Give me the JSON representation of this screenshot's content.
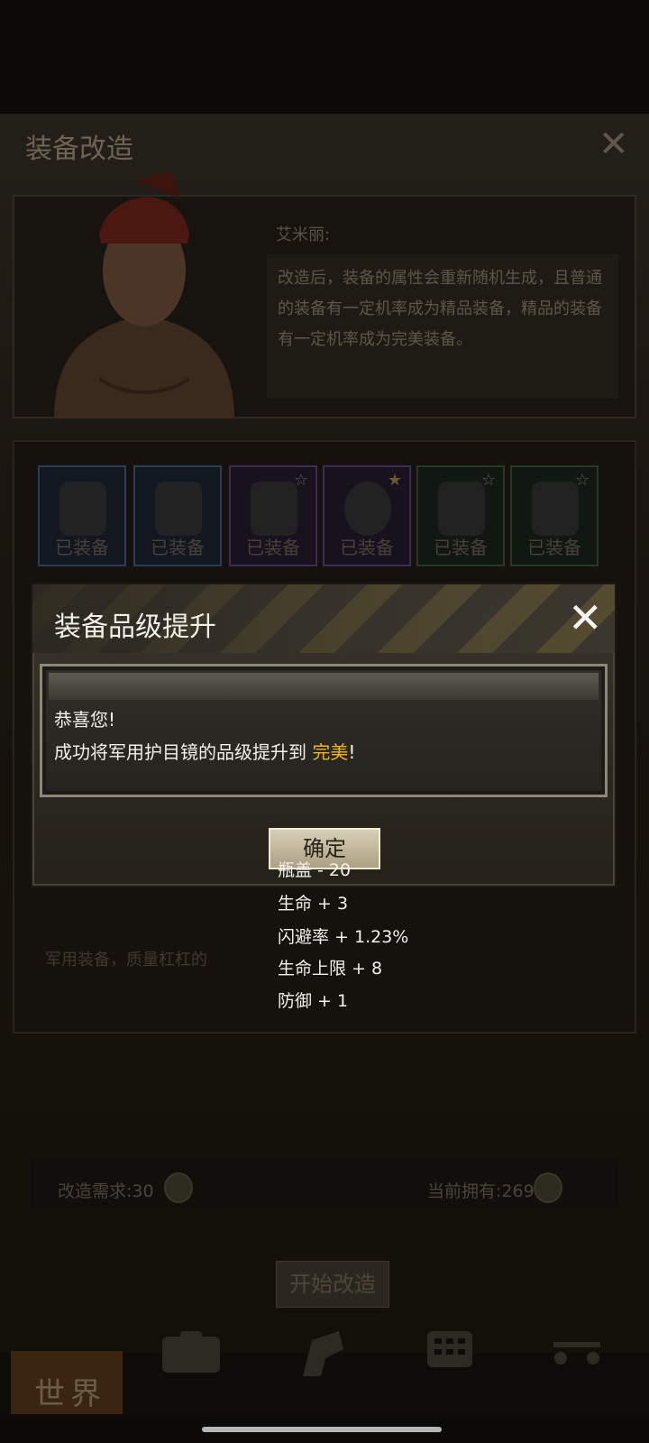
{
  "background_window": {
    "title": "装备改造",
    "npc_name": "艾米丽:",
    "npc_description": "改造后，装备的属性会重新随机生成，且普通的装备有一定机率成为精品装备，精品的装备有一定机率成为完美装备。",
    "equipment_slots": [
      {
        "tag": "已装备",
        "border": "#2a3f55",
        "bg": "#121720",
        "star": false
      },
      {
        "tag": "已装备",
        "border": "#2a3f55",
        "bg": "#121720",
        "star": false
      },
      {
        "tag": "已装备",
        "border": "#3d2a55",
        "bg": "#18121f",
        "star": true
      },
      {
        "tag": "已装备",
        "border": "#3d2a55",
        "bg": "#18121f",
        "star": true,
        "locked": true
      },
      {
        "tag": "已装备",
        "border": "#243a24",
        "bg": "#111711",
        "star": true
      },
      {
        "tag": "已装备",
        "border": "#243a24",
        "bg": "#111711",
        "star": true
      }
    ],
    "flavor_text": "军用装备，质量杠杠的",
    "requirement": "改造需求:30",
    "owned": "当前拥有:269",
    "start_button": "开始改造"
  },
  "bottom_nav": {
    "world_label": "世界",
    "items": [
      "backpack-icon",
      "character-icon",
      "building-icon",
      "cart-icon"
    ]
  },
  "dialog": {
    "title": "装备品级提升",
    "message_line1": "恭喜您!",
    "message_line2_prefix": "成功将军用护目镜的品级提升到 ",
    "quality": "完美",
    "message_line2_suffix": "!",
    "confirm_label": "确定"
  },
  "stats": [
    "瓶盖 - 20",
    "生命 + 3",
    "闪避率 + 1.23%",
    "生命上限 + 8",
    "防御 + 1"
  ],
  "colors": {
    "quality_perfect": "#f2b41e",
    "dialog_bg": "#2b2822",
    "overlay": "#0b0a08"
  }
}
